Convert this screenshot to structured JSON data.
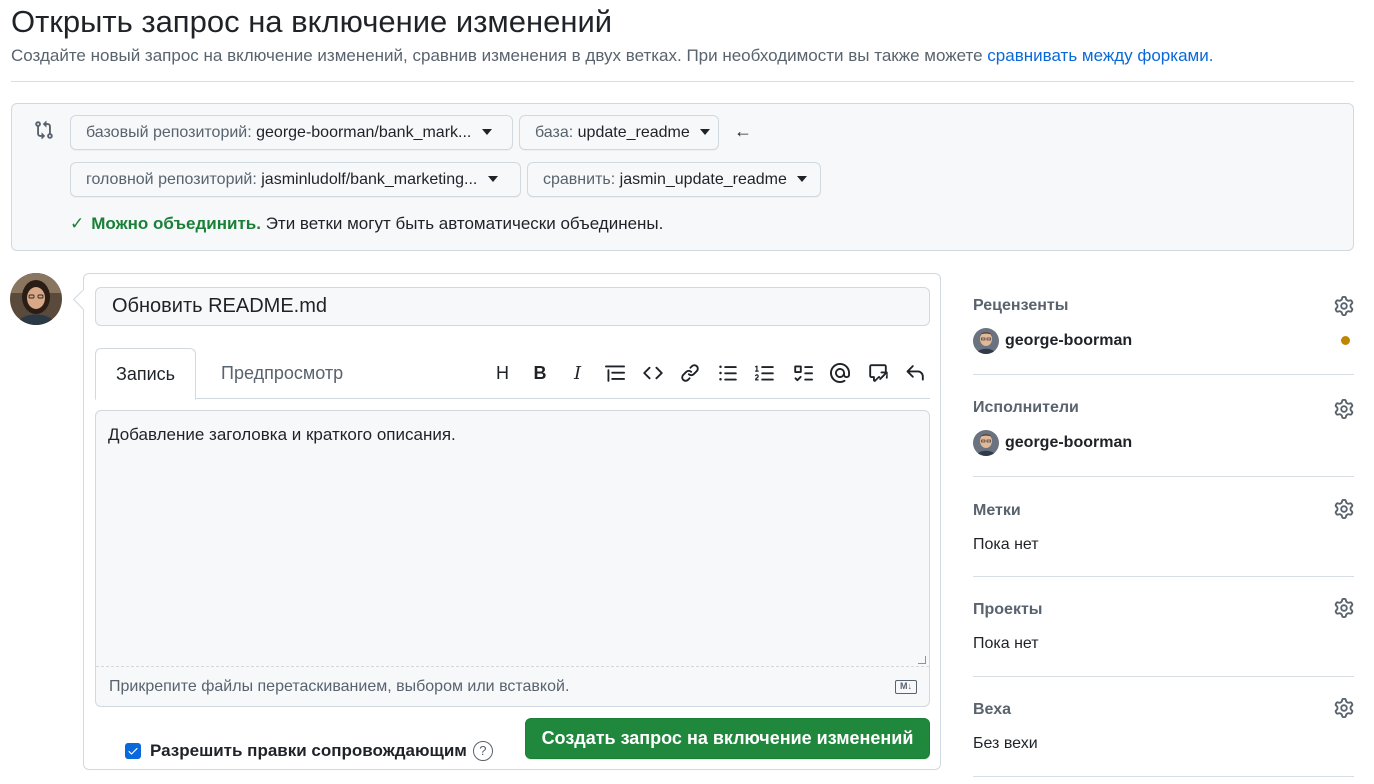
{
  "header": {
    "title": "Открыть запрос на включение изменений",
    "description": "Создайте новый запрос на включение изменений, сравнив изменения в двух ветках. При необходимости вы также можете",
    "link_text": "сравнивать между форками."
  },
  "compare": {
    "base_repo_prefix": "базовый репозиторий:",
    "base_repo_value": "george-boorman/bank_mark...",
    "base_prefix": "база:",
    "base_value": "update_readme",
    "arrow": "←",
    "head_repo_prefix": "головной репозиторий:",
    "head_repo_value": "jasminludolf/bank_marketing...",
    "compare_prefix": "сравнить:",
    "compare_value": "jasmin_update_readme",
    "status_check": "✓",
    "status_ok": "Можно объединить.",
    "status_text": "Эти ветки могут быть автоматически объединены."
  },
  "form": {
    "title_value": "Обновить README.md",
    "tab_write": "Запись",
    "tab_preview": "Предпросмотр",
    "toolbar_heading": "H",
    "toolbar_bold": "B",
    "toolbar_italic": "I",
    "body_text": "Добавление заголовка и краткого описания.",
    "attach_text": "Прикрепите файлы перетаскиванием, выбором или вставкой.",
    "markdown_badge": "M↓",
    "allow_edits_label": "Разрешить правки сопровождающим",
    "help": "?",
    "create_button": "Создать запрос на включение изменений"
  },
  "sidebar": {
    "reviewers_heading": "Рецензенты",
    "reviewer_name": "george-boorman",
    "assignees_heading": "Исполнители",
    "assignee_name": "george-boorman",
    "labels_heading": "Метки",
    "labels_value": "Пока нет",
    "projects_heading": "Проекты",
    "projects_value": "Пока нет",
    "milestone_heading": "Веха",
    "milestone_value": "Без вехи"
  },
  "colors": {
    "primary_button": "#1f883d",
    "link": "#0969da",
    "success": "#1a7f37",
    "pending": "#bf8700"
  }
}
